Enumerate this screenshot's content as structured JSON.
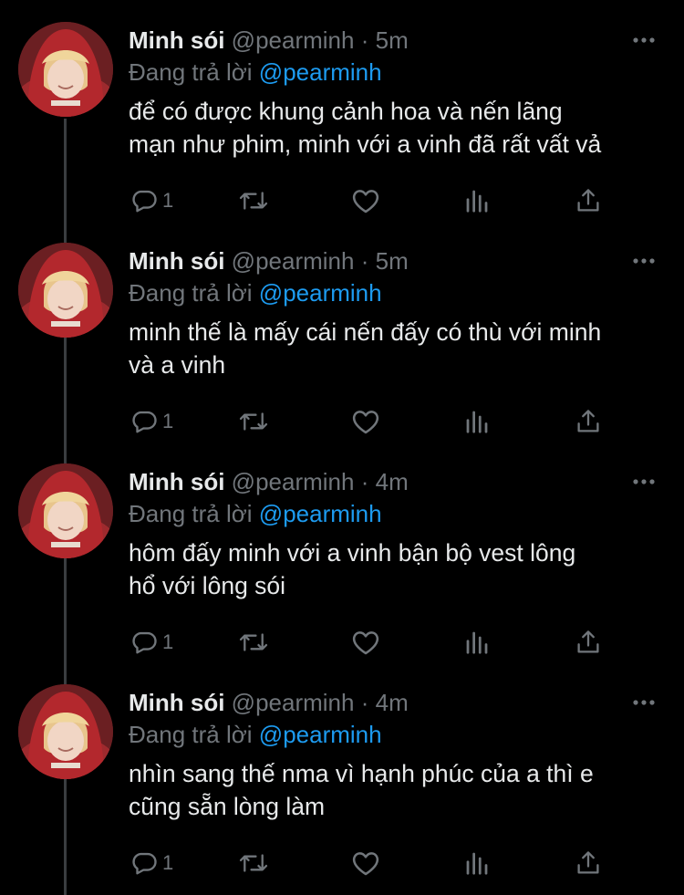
{
  "colors": {
    "background": "#000000",
    "text": "#e7e9ea",
    "muted": "#71767b",
    "accent": "#1d9bf0",
    "thread_line": "#3a3d40"
  },
  "tweets": [
    {
      "name": "Minh sói",
      "handle": "@pearminh",
      "separator": "·",
      "time": "5m",
      "reply_prefix": "Đang trả lời",
      "reply_to": "@pearminh",
      "text": "để có được khung cảnh hoa và nến lãng\nmạn như phim, minh với a vinh đã rất vất vả",
      "reply_count": "1",
      "icons": [
        "reply-icon",
        "retweet-icon",
        "like-icon",
        "stats-icon",
        "share-icon",
        "more-icon"
      ]
    },
    {
      "name": "Minh sói",
      "handle": "@pearminh",
      "separator": "·",
      "time": "5m",
      "reply_prefix": "Đang trả lời",
      "reply_to": "@pearminh",
      "text": "minh thế là mấy cái nến đấy có thù với minh\nvà a vinh",
      "reply_count": "1",
      "icons": [
        "reply-icon",
        "retweet-icon",
        "like-icon",
        "stats-icon",
        "share-icon",
        "more-icon"
      ]
    },
    {
      "name": "Minh sói",
      "handle": "@pearminh",
      "separator": "·",
      "time": "4m",
      "reply_prefix": "Đang trả lời",
      "reply_to": "@pearminh",
      "text": "hôm đấy minh với a vinh bận bộ vest lông\nhổ với lông sói",
      "reply_count": "1",
      "icons": [
        "reply-icon",
        "retweet-icon",
        "like-icon",
        "stats-icon",
        "share-icon",
        "more-icon"
      ]
    },
    {
      "name": "Minh sói",
      "handle": "@pearminh",
      "separator": "·",
      "time": "4m",
      "reply_prefix": "Đang trả lời",
      "reply_to": "@pearminh",
      "text": "nhìn sang thế nma vì hạnh phúc của a thì e\ncũng sẵn lòng làm",
      "reply_count": "1",
      "icons": [
        "reply-icon",
        "retweet-icon",
        "like-icon",
        "stats-icon",
        "share-icon",
        "more-icon"
      ]
    }
  ]
}
